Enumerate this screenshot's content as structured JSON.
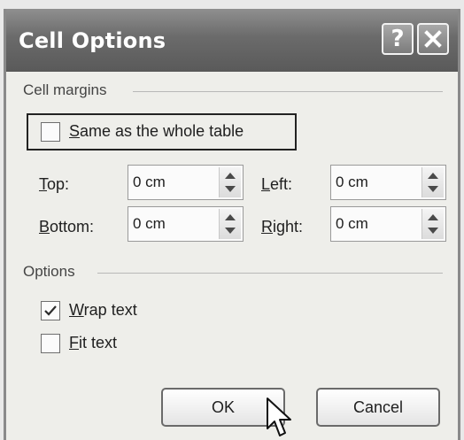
{
  "dialog": {
    "title": "Cell Options",
    "help_glyph": "?",
    "close_icon": "close-icon"
  },
  "cell_margins": {
    "group_label": "Cell margins",
    "same_as_table": {
      "label_u": "S",
      "label_rest": "ame as the whole table",
      "checked": false
    },
    "top": {
      "label_u": "T",
      "label_rest": "op:",
      "value": "0 cm"
    },
    "bottom": {
      "label_u": "B",
      "label_rest": "ottom:",
      "value": "0 cm"
    },
    "left": {
      "label_u": "L",
      "label_rest": "eft:",
      "value": "0 cm"
    },
    "right": {
      "label_u": "R",
      "label_rest": "ight:",
      "value": "0 cm"
    }
  },
  "options": {
    "group_label": "Options",
    "wrap_text": {
      "label_u": "W",
      "label_rest": "rap text",
      "checked": true
    },
    "fit_text": {
      "label_u": "F",
      "label_rest": "it text",
      "checked": false
    }
  },
  "buttons": {
    "ok_label": "OK",
    "cancel_label": "Cancel"
  }
}
